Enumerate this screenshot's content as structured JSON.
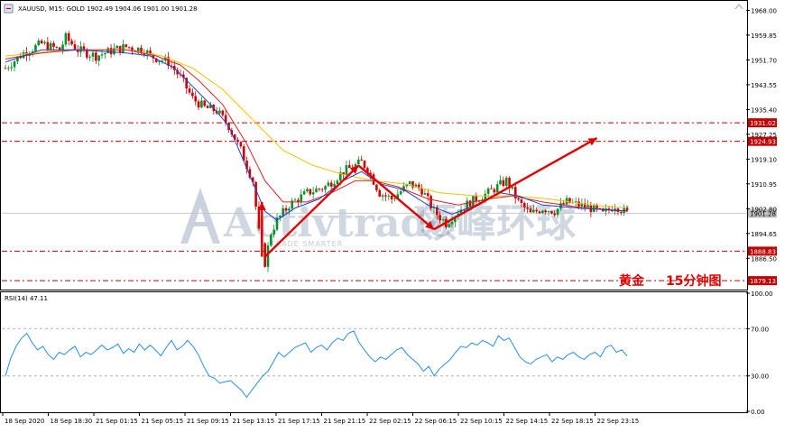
{
  "header": {
    "symbol_info": "XAUUSD, M15:  GOLD  1902.49 1904.06 1901.00 1901.28",
    "rsi_label": "RSI(14) 47.11"
  },
  "watermark": {
    "brand": "Activtrade",
    "cn": "领峰环球",
    "tagline": "TRADE SMARTER"
  },
  "caption": {
    "title": "黄金",
    "subtitle": "15分钟图"
  },
  "colors": {
    "bull": "#0a8f2a",
    "bear": "#d00000",
    "ma_fast": "#1b3fd6",
    "ma_mid": "#e02020",
    "ma_slow": "#f2c200",
    "rsi": "#2a8fe0",
    "arrow": "#e00000",
    "level": "#c00000"
  },
  "chart_data": [
    {
      "type": "candlestick",
      "symbol": "XAUUSD",
      "timeframe": "M15",
      "ylim": [
        1876.5,
        1970.8
      ],
      "y_ticks": [
        1968.0,
        1959.85,
        1951.7,
        1943.55,
        1935.4,
        1927.25,
        1919.1,
        1910.95,
        1902.8,
        1894.65,
        1886.5
      ],
      "x_tick_labels": [
        "18 Sep 2020",
        "18 Sep 18:30",
        "21 Sep 01:15",
        "21 Sep 05:15",
        "21 Sep 09:15",
        "21 Sep 13:15",
        "21 Sep 17:15",
        "21 Sep 21:15",
        "22 Sep 02:15",
        "22 Sep 06:15",
        "22 Sep 10:15",
        "22 Sep 14:15",
        "22 Sep 18:15",
        "22 Sep 23:15"
      ],
      "horizontal_levels": [
        {
          "price": 1931.02,
          "label": "1931.02"
        },
        {
          "price": 1924.93,
          "label": "1924.93"
        },
        {
          "price": 1888.83,
          "label": "1888.83"
        },
        {
          "price": 1879.13,
          "label": "1879.13"
        }
      ],
      "current_price": {
        "price": 1901.28,
        "label": "1901.28"
      },
      "close_path": [
        [
          0,
          1949
        ],
        [
          6,
          1954
        ],
        [
          12,
          1957
        ],
        [
          18,
          1955
        ],
        [
          20,
          1959
        ],
        [
          24,
          1955
        ],
        [
          30,
          1953
        ],
        [
          36,
          1955
        ],
        [
          40,
          1956
        ],
        [
          46,
          1955
        ],
        [
          48,
          1953
        ],
        [
          54,
          1951
        ],
        [
          58,
          1946
        ],
        [
          62,
          1939
        ],
        [
          66,
          1936
        ],
        [
          70,
          1935
        ],
        [
          74,
          1930
        ],
        [
          78,
          1922
        ],
        [
          82,
          1912
        ],
        [
          84,
          1895
        ],
        [
          86,
          1885
        ],
        [
          88,
          1895
        ],
        [
          90,
          1899
        ],
        [
          94,
          1904
        ],
        [
          100,
          1908
        ],
        [
          106,
          1910
        ],
        [
          112,
          1915
        ],
        [
          118,
          1918
        ],
        [
          120,
          1916
        ],
        [
          124,
          1908
        ],
        [
          128,
          1906
        ],
        [
          134,
          1911
        ],
        [
          138,
          1909
        ],
        [
          142,
          1902
        ],
        [
          146,
          1898
        ],
        [
          150,
          1902
        ],
        [
          154,
          1905
        ],
        [
          160,
          1908
        ],
        [
          166,
          1912
        ],
        [
          170,
          1905
        ],
        [
          174,
          1901
        ],
        [
          178,
          1903
        ],
        [
          182,
          1902
        ],
        [
          186,
          1905
        ],
        [
          190,
          1904
        ],
        [
          194,
          1903
        ],
        [
          198,
          1901
        ],
        [
          202,
          1904
        ],
        [
          206,
          1901.28
        ]
      ],
      "ma_fast_path": [
        [
          0,
          1951
        ],
        [
          12,
          1955
        ],
        [
          24,
          1955
        ],
        [
          40,
          1954
        ],
        [
          48,
          1953
        ],
        [
          56,
          1949
        ],
        [
          62,
          1943
        ],
        [
          68,
          1937
        ],
        [
          74,
          1930
        ],
        [
          80,
          1916
        ],
        [
          86,
          1902
        ],
        [
          90,
          1899
        ],
        [
          96,
          1903
        ],
        [
          104,
          1906
        ],
        [
          112,
          1912
        ],
        [
          118,
          1915
        ],
        [
          124,
          1911
        ],
        [
          132,
          1909
        ],
        [
          140,
          1904
        ],
        [
          148,
          1901
        ],
        [
          156,
          1904
        ],
        [
          164,
          1908
        ],
        [
          170,
          1907
        ],
        [
          178,
          1904
        ],
        [
          190,
          1903
        ],
        [
          206,
          1902
        ]
      ],
      "ma_mid_path": [
        [
          0,
          1952
        ],
        [
          12,
          1954
        ],
        [
          24,
          1955
        ],
        [
          40,
          1955
        ],
        [
          50,
          1953
        ],
        [
          58,
          1950
        ],
        [
          64,
          1945
        ],
        [
          72,
          1937
        ],
        [
          80,
          1924
        ],
        [
          86,
          1912
        ],
        [
          92,
          1905
        ],
        [
          100,
          1905
        ],
        [
          108,
          1908
        ],
        [
          116,
          1912
        ],
        [
          122,
          1912
        ],
        [
          130,
          1910
        ],
        [
          140,
          1906
        ],
        [
          150,
          1904
        ],
        [
          160,
          1906
        ],
        [
          168,
          1907
        ],
        [
          178,
          1905
        ],
        [
          192,
          1903
        ],
        [
          206,
          1902
        ]
      ],
      "ma_slow_path": [
        [
          0,
          1953
        ],
        [
          20,
          1955
        ],
        [
          40,
          1955
        ],
        [
          52,
          1953
        ],
        [
          62,
          1949
        ],
        [
          72,
          1942
        ],
        [
          82,
          1932
        ],
        [
          92,
          1922
        ],
        [
          102,
          1917
        ],
        [
          112,
          1914
        ],
        [
          122,
          1912
        ],
        [
          132,
          1911
        ],
        [
          144,
          1908
        ],
        [
          156,
          1907
        ],
        [
          168,
          1907
        ],
        [
          180,
          1906
        ],
        [
          194,
          1904
        ],
        [
          206,
          1903
        ]
      ],
      "annotation_arrows": [
        {
          "from": [
            85,
            1887
          ],
          "to": [
            85,
            1905
          ]
        },
        {
          "from": [
            86,
            1887
          ],
          "to": [
            117,
            1917
          ]
        },
        {
          "from": [
            117,
            1917
          ],
          "to": [
            142,
            1896
          ]
        },
        {
          "from": [
            142,
            1896
          ],
          "to": [
            196,
            1926
          ]
        }
      ]
    },
    {
      "type": "line",
      "indicator": "RSI(14)",
      "ylim": [
        0,
        100
      ],
      "y_ticks": [
        100.0,
        70.0,
        30.0,
        0.0
      ],
      "levels": [
        70,
        30
      ],
      "values": [
        30,
        45,
        55,
        62,
        66,
        58,
        52,
        55,
        48,
        44,
        50,
        48,
        52,
        55,
        46,
        50,
        48,
        52,
        56,
        52,
        54,
        57,
        49,
        53,
        50,
        57,
        52,
        56,
        52,
        47,
        54,
        60,
        52,
        55,
        60,
        55,
        48,
        38,
        30,
        28,
        24,
        25,
        26,
        22,
        18,
        12,
        18,
        24,
        30,
        34,
        42,
        50,
        46,
        50,
        54,
        56,
        58,
        50,
        54,
        56,
        52,
        58,
        62,
        60,
        66,
        68,
        58,
        52,
        46,
        42,
        46,
        44,
        48,
        52,
        54,
        48,
        44,
        40,
        34,
        38,
        30,
        36,
        40,
        44,
        50,
        55,
        54,
        58,
        56,
        60,
        58,
        55,
        64,
        60,
        62,
        54,
        46,
        42,
        40,
        44,
        46,
        48,
        42,
        46,
        44,
        48,
        50,
        46,
        44,
        48,
        50,
        46,
        54,
        56,
        50,
        52,
        47
      ]
    }
  ]
}
